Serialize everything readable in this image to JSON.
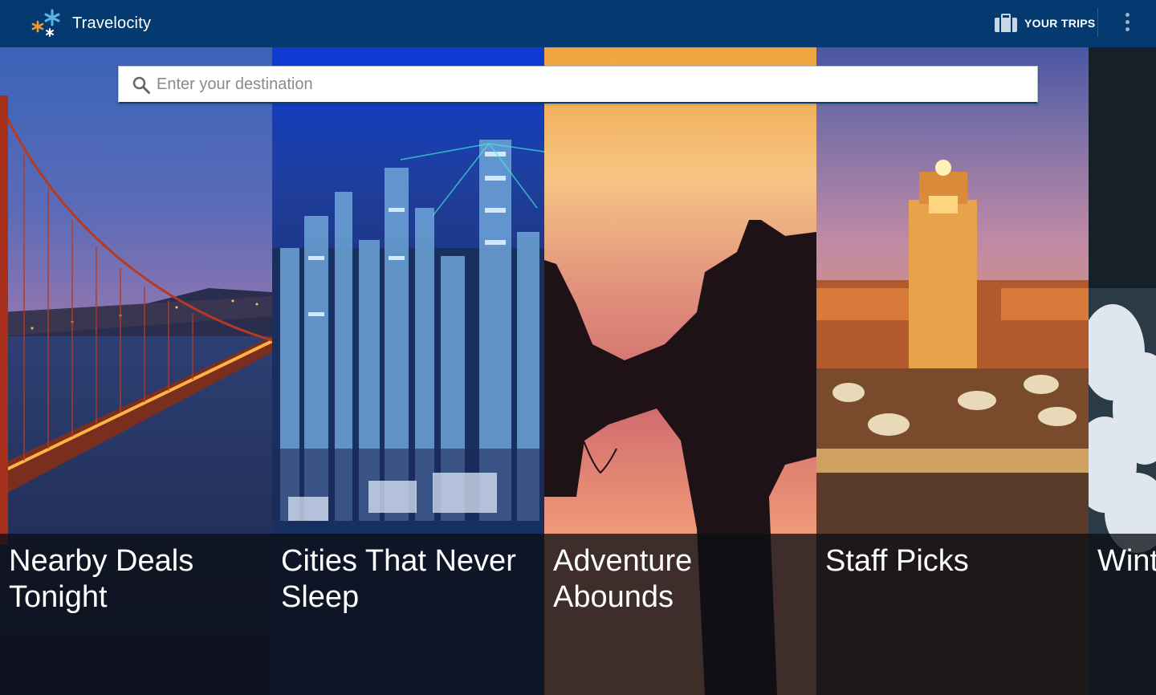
{
  "app": {
    "name": "Travelocity",
    "logo_icon": "travelocity-star-logo",
    "bar_color": "#043a70"
  },
  "header": {
    "trips_label": "YOUR TRIPS",
    "trips_icon": "suitcase-icon",
    "overflow_icon": "more-vert-icon"
  },
  "search": {
    "value": "",
    "placeholder": "Enter your destination",
    "icon": "search-icon"
  },
  "cards": [
    {
      "title": "Nearby Deals Tonight",
      "scene": "golden-gate-bridge-at-dusk"
    },
    {
      "title": "Cities That Never Sleep",
      "scene": "hong-kong-skyline-at-night"
    },
    {
      "title": "Adventure Abounds",
      "scene": "camel-silhouette-at-sunset"
    },
    {
      "title": "Staff Picks",
      "scene": "marrakech-square-at-night"
    },
    {
      "title": "Winter Wonderland",
      "scene": "snowy-forest"
    }
  ]
}
